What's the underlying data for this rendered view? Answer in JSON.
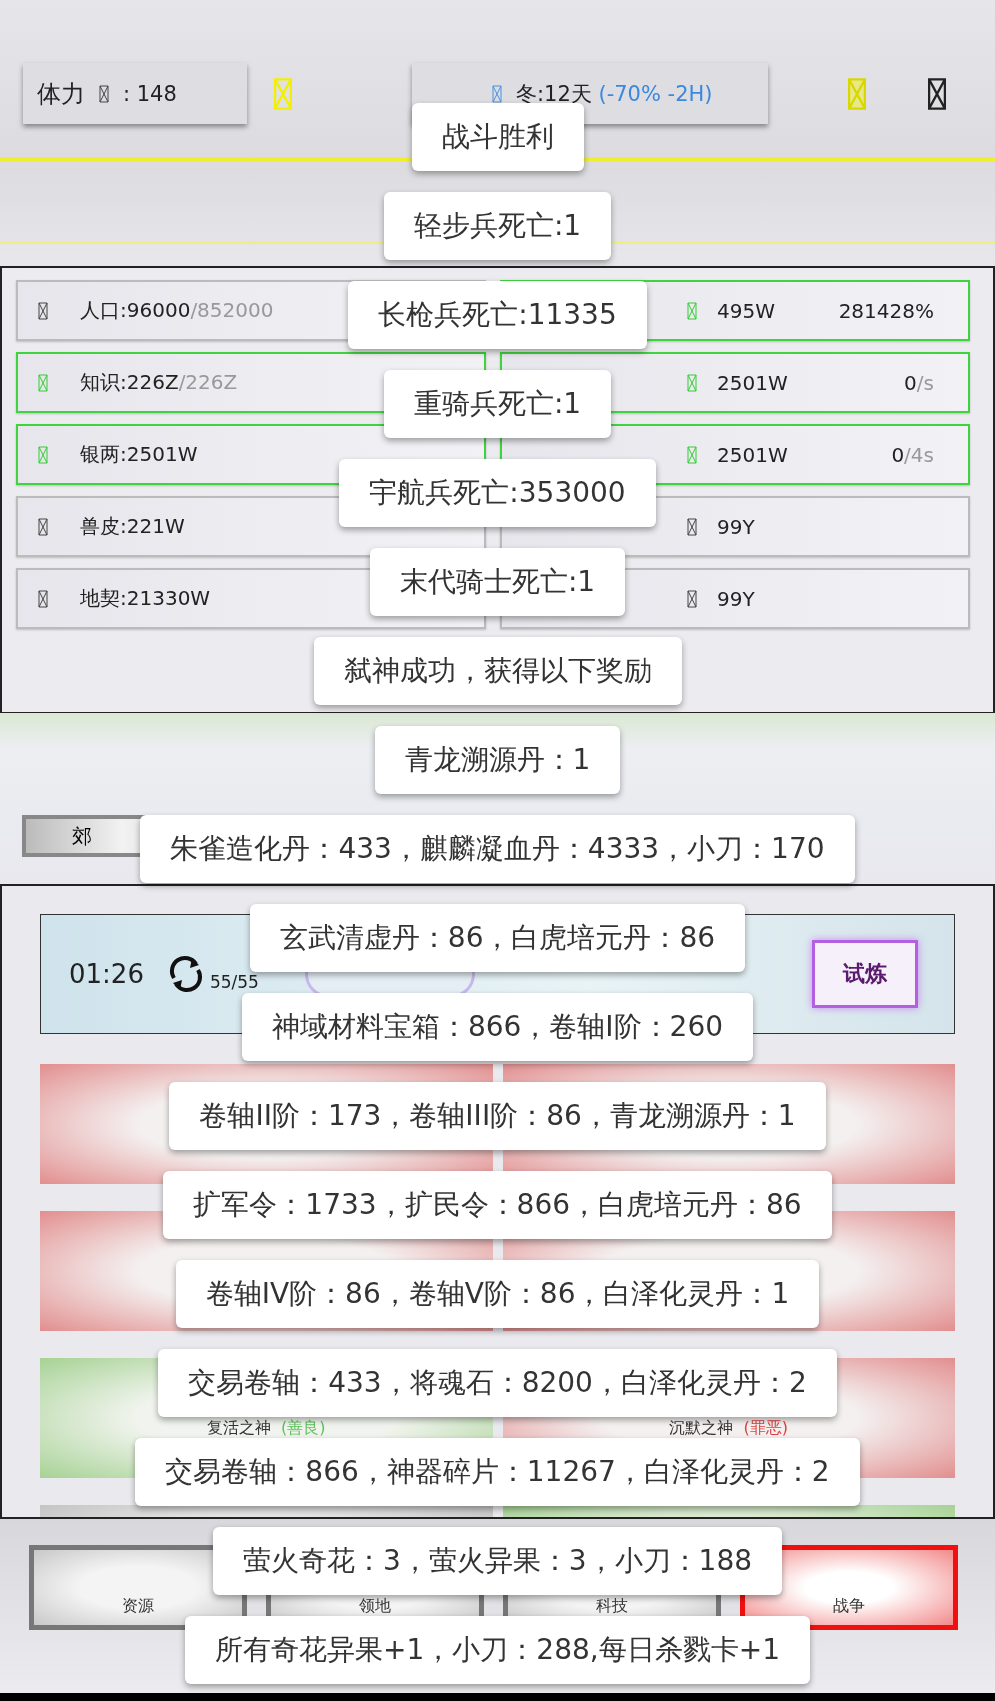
{
  "top_bar": {
    "stamina": {
      "label": "体力",
      "value": ": 148"
    },
    "season": {
      "text": "冬:12天",
      "modifier": "(-70% -2H)"
    }
  },
  "resources": [
    {
      "label": "人口:96000",
      "suffix": "/852000",
      "highlighted": false
    },
    {
      "label": "495W",
      "value": "281428%",
      "highlighted": true
    },
    {
      "label": "知识:226Z",
      "suffix": "/226Z",
      "highlighted": true
    },
    {
      "label": "2501W",
      "value": "0",
      "value_suffix": "/s",
      "highlighted": true
    },
    {
      "label": "银两:2501W",
      "highlighted": true
    },
    {
      "label": "2501W",
      "value": "0",
      "value_suffix": "/4s",
      "highlighted": true
    },
    {
      "label": "兽皮:221W",
      "highlighted": false
    },
    {
      "label": "99Y",
      "highlighted": false
    },
    {
      "label": "地契:21330W",
      "highlighted": false
    },
    {
      "label": "99Y",
      "highlighted": false
    }
  ],
  "outskirts_button": "郊",
  "gods": {
    "timer": "01:26",
    "count": "55/55",
    "trial_button": "试炼",
    "cards": [
      {
        "kind": "red"
      },
      {
        "kind": "red"
      },
      {
        "kind": "red"
      },
      {
        "kind": "red"
      },
      {
        "kind": "green",
        "name": "复活之神",
        "tag": "(善良)"
      },
      {
        "kind": "red",
        "name": "沉默之神",
        "tag": "(罪恶)"
      },
      {
        "kind": "grey"
      },
      {
        "kind": "green"
      }
    ]
  },
  "nav": [
    {
      "label": "资源",
      "selected": false
    },
    {
      "label": "领地",
      "selected": false
    },
    {
      "label": "科技",
      "selected": false
    },
    {
      "label": "战争",
      "selected": true
    }
  ],
  "toasts": [
    "战斗胜利",
    "轻步兵死亡:1",
    "长枪兵死亡:11335",
    "重骑兵死亡:1",
    "宇航兵死亡:353000",
    "末代骑士死亡:1",
    "弑神成功，获得以下奖励",
    "青龙溯源丹：1",
    "朱雀造化丹：433，麒麟凝血丹：4333，小刀：170",
    "玄武清虚丹：86，白虎培元丹：86",
    "神域材料宝箱：866，卷轴I阶：260",
    "卷轴II阶：173，卷轴III阶：86，青龙溯源丹：1",
    "扩军令：1733，扩民令：866，白虎培元丹：86",
    "卷轴IV阶：86，卷轴V阶：86，白泽化灵丹：1",
    "交易卷轴：433，将魂石：8200，白泽化灵丹：2",
    "交易卷轴：866，神器碎片：11267，白泽化灵丹：2",
    "萤火奇花：3，萤火异果：3，小刀：188",
    "所有奇花异果+1，小刀：288,每日杀戮卡+1"
  ]
}
